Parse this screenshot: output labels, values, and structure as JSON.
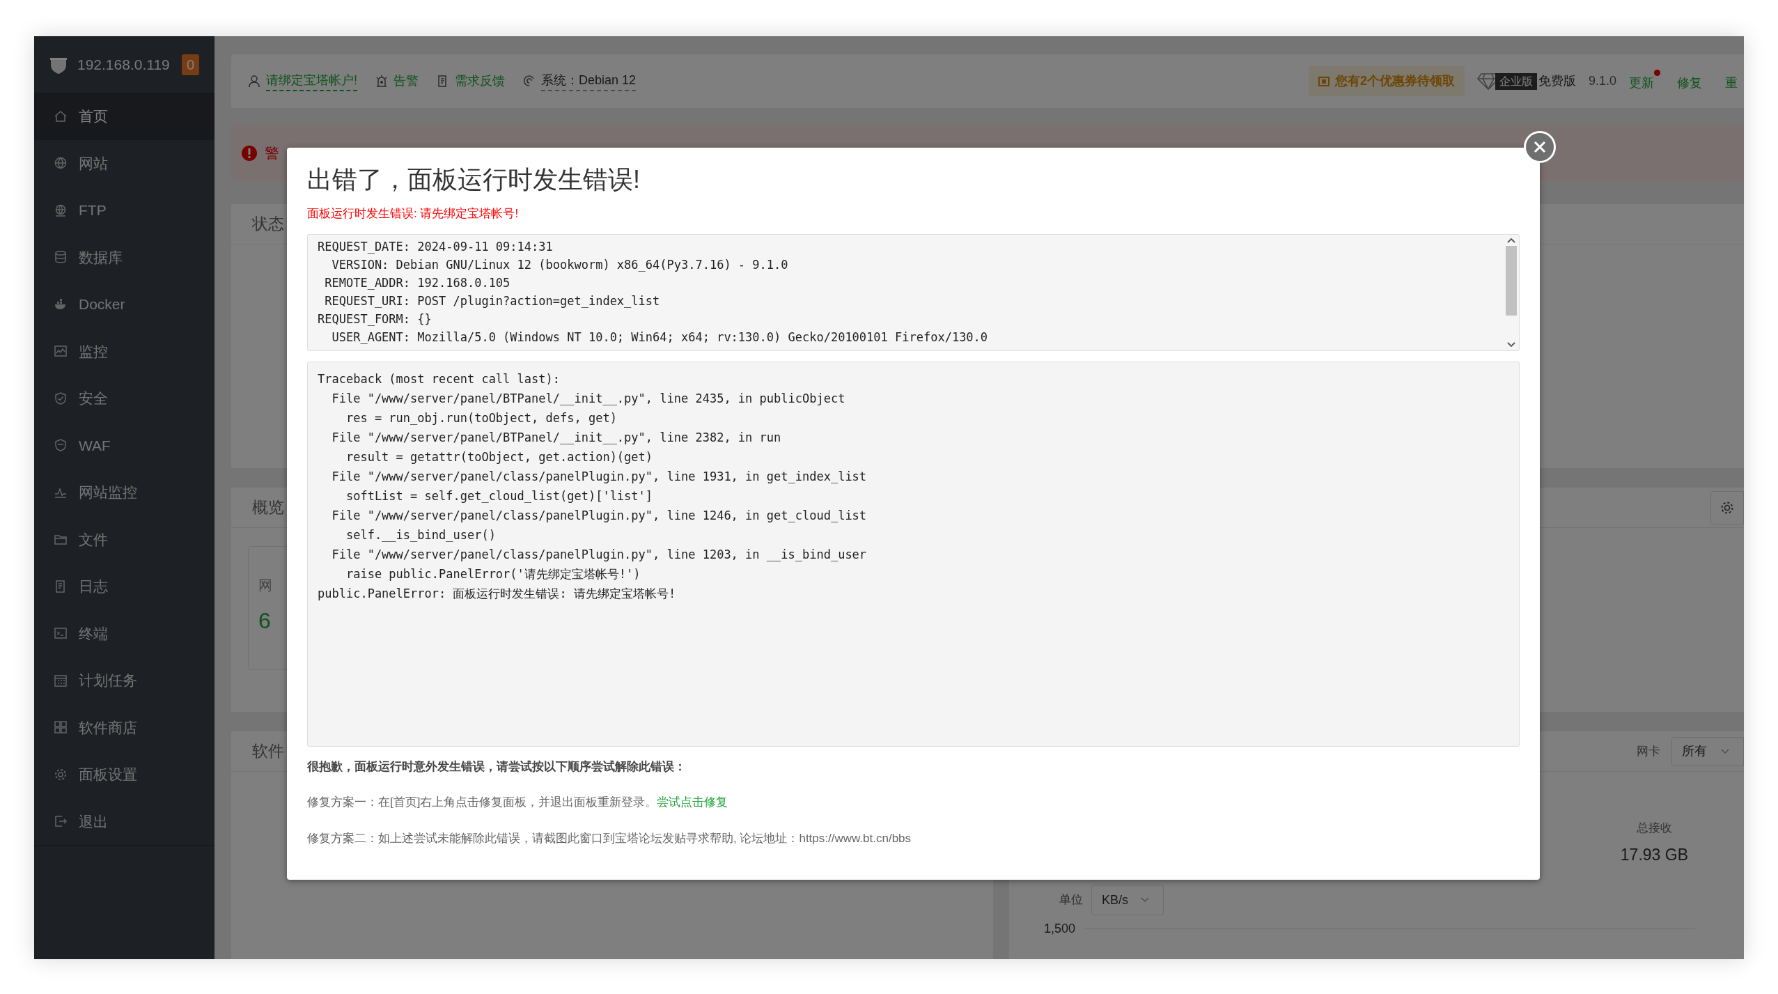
{
  "sidebar": {
    "host": "192.168.0.119",
    "badge": "0",
    "items": [
      {
        "label": "首页",
        "selected": true
      },
      {
        "label": "网站",
        "selected": false
      },
      {
        "label": "FTP",
        "selected": false
      },
      {
        "label": "数据库",
        "selected": false
      },
      {
        "label": "Docker",
        "selected": false
      },
      {
        "label": "监控",
        "selected": false
      },
      {
        "label": "安全",
        "selected": false
      },
      {
        "label": "WAF",
        "selected": false
      },
      {
        "label": "网站监控",
        "selected": false
      },
      {
        "label": "文件",
        "selected": false
      },
      {
        "label": "日志",
        "selected": false
      },
      {
        "label": "终端",
        "selected": false
      },
      {
        "label": "计划任务",
        "selected": false
      },
      {
        "label": "软件商店",
        "selected": false
      },
      {
        "label": "面板设置",
        "selected": false
      },
      {
        "label": "退出",
        "selected": false
      }
    ]
  },
  "top_bar": {
    "links": [
      {
        "label": "请绑定宝塔帐户!",
        "kind": "account"
      },
      {
        "label": "告警",
        "kind": "alarm"
      },
      {
        "label": "需求反馈",
        "kind": "feedback"
      },
      {
        "label": "系统：Debian 12",
        "kind": "system"
      }
    ],
    "coupon": "您有2个优惠券待领取",
    "enterprise_badge": "企业版",
    "edition": "免费版",
    "version": "9.1.0",
    "actions": [
      {
        "label": "更新",
        "notification": true
      },
      {
        "label": "修复",
        "notification": false
      },
      {
        "label": "重",
        "notification": false
      }
    ]
  },
  "alert": {
    "text": "警"
  },
  "status_panel": {
    "title": "状态"
  },
  "overview_panel": {
    "title": "概览",
    "card_label": "网",
    "card_value": "6"
  },
  "software_panel": {
    "title": "软件"
  },
  "network_panel": {
    "nic_label": "网卡",
    "nic_value": "所有",
    "total_label": "总接收",
    "total_value": "17.93 GB",
    "unit_label": "单位",
    "unit_value": "KB/s",
    "tick": "1,500"
  },
  "modal": {
    "title": "出错了，面板运行时发生错误!",
    "subtitle": "面板运行时发生错误: 请先绑定宝塔帐号!",
    "request_lines": [
      "REQUEST_DATE: 2024-09-11 09:14:31",
      "  VERSION: Debian GNU/Linux 12 (bookworm) x86_64(Py3.7.16) - 9.1.0",
      " REMOTE_ADDR: 192.168.0.105",
      " REQUEST_URI: POST /plugin?action=get_index_list",
      "REQUEST_FORM: {}",
      "  USER_AGENT: Mozilla/5.0 (Windows NT 10.0; Win64; x64; rv:130.0) Gecko/20100101 Firefox/130.0"
    ],
    "traceback_lines": [
      "Traceback (most recent call last):",
      "  File \"/www/server/panel/BTPanel/__init__.py\", line 2435, in publicObject",
      "    res = run_obj.run(toObject, defs, get)",
      "  File \"/www/server/panel/BTPanel/__init__.py\", line 2382, in run",
      "    result = getattr(toObject, get.action)(get)",
      "  File \"/www/server/panel/class/panelPlugin.py\", line 1931, in get_index_list",
      "    softList = self.get_cloud_list(get)['list']",
      "  File \"/www/server/panel/class/panelPlugin.py\", line 1246, in get_cloud_list",
      "    self.__is_bind_user()",
      "  File \"/www/server/panel/class/panelPlugin.py\", line 1203, in __is_bind_user",
      "    raise public.PanelError('请先绑定宝塔帐号!')",
      "public.PanelError: 面板运行时发生错误: 请先绑定宝塔帐号!"
    ],
    "apology": "很抱歉，面板运行时意外发生错误，请尝试按以下顺序尝试解除此错误：",
    "plans": [
      {
        "text": "修复方案一：在[首页]右上角点击修复面板，并退出面板重新登录。",
        "link": "尝试点击修复"
      },
      {
        "text": "修复方案二：如上述尝试未能解除此错误，请截图此窗口到宝塔论坛发贴寻求帮助, 论坛地址：https://www.bt.cn/bbs"
      }
    ]
  }
}
